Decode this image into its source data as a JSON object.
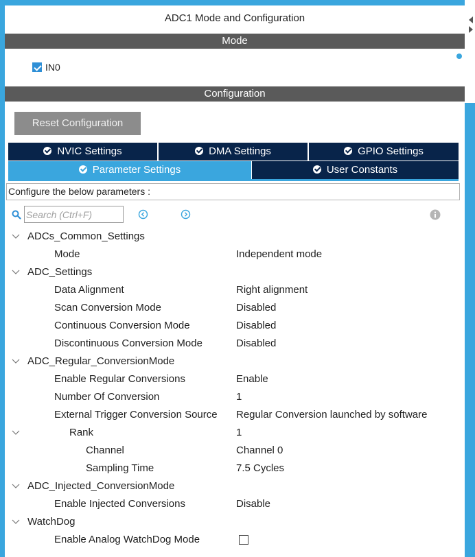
{
  "panel": {
    "title": "ADC1 Mode and Configuration"
  },
  "mode_section": {
    "header": "Mode",
    "in0": {
      "label": "IN0",
      "checked": true
    }
  },
  "config_section": {
    "header": "Configuration",
    "reset_label": "Reset Configuration",
    "tabs": [
      {
        "label": "NVIC Settings",
        "active": false
      },
      {
        "label": "DMA Settings",
        "active": false
      },
      {
        "label": "GPIO Settings",
        "active": false
      },
      {
        "label": "Parameter Settings",
        "active": true
      },
      {
        "label": "User Constants",
        "active": false
      }
    ],
    "configure_text": "Configure the below parameters :",
    "search": {
      "placeholder": "Search (Ctrl+F)",
      "value": ""
    }
  },
  "tree": {
    "g1": {
      "label": "ADCs_Common_Settings"
    },
    "mode": {
      "name": "Mode",
      "value": "Independent mode"
    },
    "g2": {
      "label": "ADC_Settings"
    },
    "data_alignment": {
      "name": "Data Alignment",
      "value": "Right alignment"
    },
    "scan": {
      "name": "Scan Conversion Mode",
      "value": "Disabled"
    },
    "continuous": {
      "name": "Continuous Conversion Mode",
      "value": "Disabled"
    },
    "discontinuous": {
      "name": "Discontinuous Conversion Mode",
      "value": "Disabled"
    },
    "g3": {
      "label": "ADC_Regular_ConversionMode"
    },
    "enable_regular": {
      "name": "Enable Regular Conversions",
      "value": "Enable"
    },
    "num_conversion": {
      "name": "Number Of Conversion",
      "value": "1"
    },
    "ext_trigger": {
      "name": "External Trigger Conversion Source",
      "value": "Regular Conversion launched by software"
    },
    "rank": {
      "name": "Rank",
      "value": "1"
    },
    "channel": {
      "name": "Channel",
      "value": "Channel 0"
    },
    "sampling": {
      "name": "Sampling Time",
      "value": "7.5 Cycles"
    },
    "g4": {
      "label": "ADC_Injected_ConversionMode"
    },
    "enable_injected": {
      "name": "Enable Injected Conversions",
      "value": "Disable"
    },
    "g5": {
      "label": "WatchDog"
    },
    "watchdog_mode": {
      "name": "Enable Analog WatchDog Mode",
      "checked": false
    }
  },
  "colors": {
    "accent": "#3aa6de",
    "tab_dark": "#08244a",
    "section_bar": "#5a5a5a",
    "button_gray": "#8c8c8c"
  },
  "icons": {
    "collapse": "chevron-down-icon",
    "tab_status": "check-circle-icon",
    "search": "search-icon",
    "prev": "prev-icon",
    "next": "next-icon",
    "info": "info-icon"
  }
}
